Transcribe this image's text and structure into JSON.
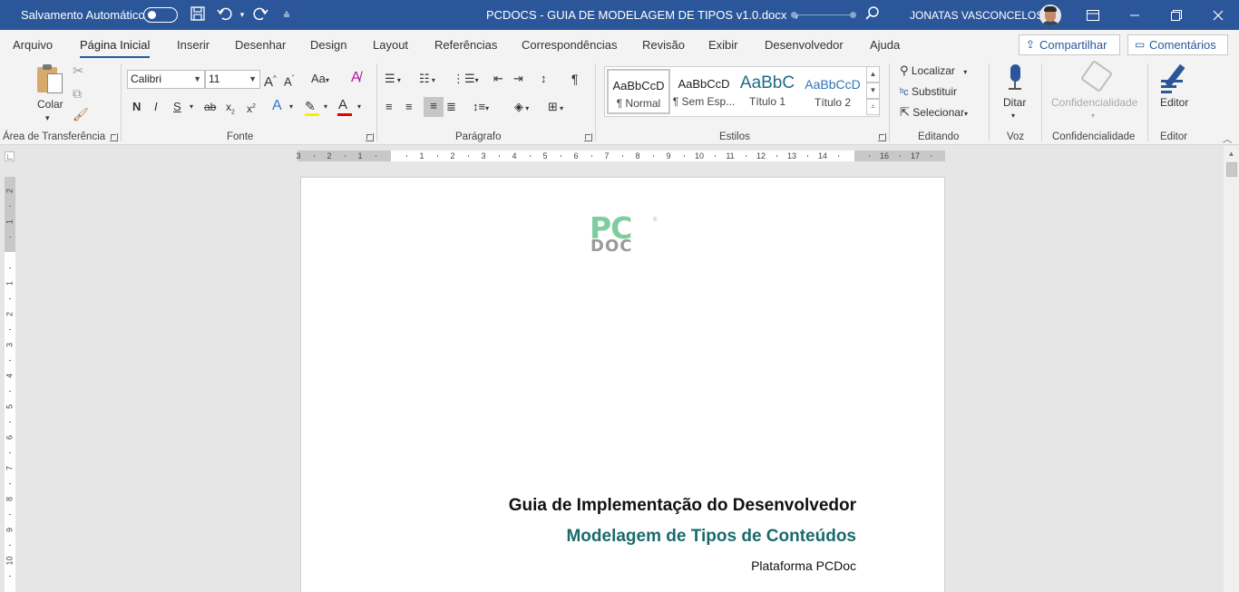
{
  "titlebar": {
    "autosave_label": "Salvamento Automático",
    "document_title": "PCDOCS - GUIA DE MODELAGEM DE TIPOS v1.0.docx",
    "user_name": "JONATAS VASCONCELOS",
    "accent_color": "#2b579a"
  },
  "menu": {
    "tabs": [
      "Arquivo",
      "Página Inicial",
      "Inserir",
      "Desenhar",
      "Design",
      "Layout",
      "Referências",
      "Correspondências",
      "Revisão",
      "Exibir",
      "Desenvolvedor",
      "Ajuda"
    ],
    "active_tab": "Página Inicial",
    "share_label": "Compartilhar",
    "comments_label": "Comentários"
  },
  "ribbon": {
    "clipboard": {
      "paste_label": "Colar",
      "group_label": "Área de Transferência"
    },
    "font": {
      "font_name": "Calibri",
      "font_size": "11",
      "group_label": "Fonte",
      "bold": "N",
      "italic": "I",
      "underline": "S"
    },
    "paragraph": {
      "group_label": "Parágrafo"
    },
    "styles": {
      "group_label": "Estilos",
      "items": [
        {
          "sample": "AaBbCcD",
          "name": "¶ Normal"
        },
        {
          "sample": "AaBbCcD",
          "name": "¶ Sem Esp..."
        },
        {
          "sample": "AaBbC",
          "name": "Título 1"
        },
        {
          "sample": "AaBbCcD",
          "name": "Título 2"
        }
      ]
    },
    "editing": {
      "find_label": "Localizar",
      "replace_label": "Substituir",
      "select_label": "Selecionar",
      "group_label": "Editando"
    },
    "voice": {
      "dictate_label": "Ditar",
      "group_label": "Voz"
    },
    "sensitivity": {
      "button_label": "Confidencialidade",
      "group_label": "Confidencialidade"
    },
    "editor": {
      "button_label": "Editor",
      "group_label": "Editor"
    }
  },
  "ruler": {
    "h_numbers": [
      "3",
      "2",
      "1",
      "1",
      "2",
      "3",
      "4",
      "5",
      "6",
      "7",
      "8",
      "9",
      "10",
      "11",
      "12",
      "13",
      "14",
      "16",
      "17"
    ],
    "v_numbers": [
      "2",
      "1",
      "1",
      "2",
      "3",
      "4",
      "5",
      "6",
      "7",
      "8",
      "9",
      "10"
    ]
  },
  "document": {
    "logo_text_top": "PC",
    "logo_text_bottom": "DOC",
    "logo_mark": "®",
    "heading": "Guia de Implementação do Desenvolvedor",
    "subheading": "Modelagem de Tipos de Conteúdos",
    "platform": "Plataforma PCDoc",
    "subheading_color": "#1a6b6b",
    "logo_color": "#7fcd9f"
  }
}
